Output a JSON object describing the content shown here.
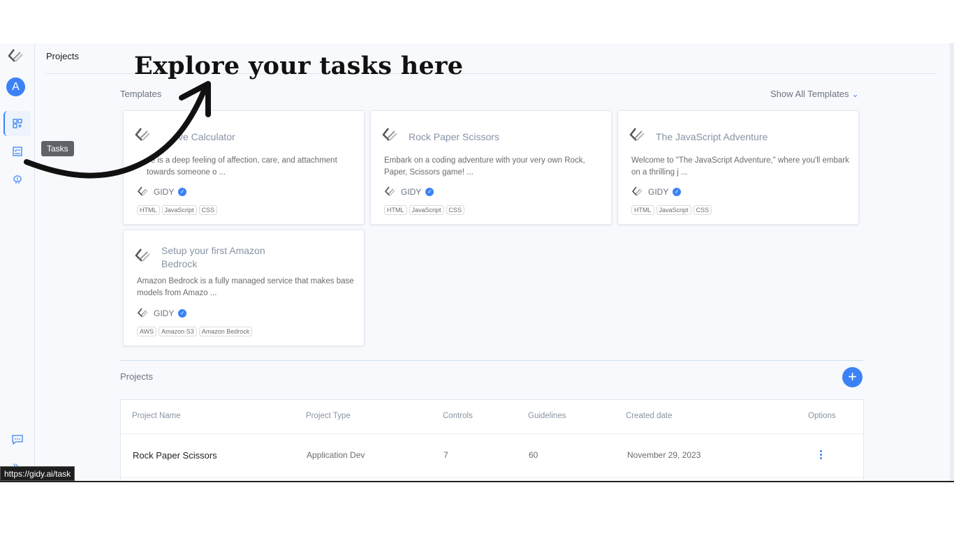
{
  "page": {
    "breadcrumb": "Projects"
  },
  "sidebar": {
    "avatar_letter": "A",
    "tooltip": "Tasks"
  },
  "annotation": {
    "text": "Explore your tasks here"
  },
  "templates": {
    "heading": "Templates",
    "show_all_label": "Show All Templates",
    "cards": [
      {
        "title": "Love Calculator",
        "title_visible": "ve Calculator",
        "description": "Love is a deep feeling of affection, care, and attachment towards someone o ...",
        "description_visible": "ve is a deep feeling of affection, care, and attachment towards someone o ...",
        "author": "GIDY",
        "tags": [
          "HTML",
          "JavaScript",
          "CSS"
        ]
      },
      {
        "title": "Rock Paper Scissors",
        "description": "Embark on a coding adventure with your very own Rock, Paper, Scissors game! ...",
        "author": "GIDY",
        "tags": [
          "HTML",
          "JavaScript",
          "CSS"
        ]
      },
      {
        "title": "The JavaScript Adventure",
        "description": "Welcome to \"The JavaScript Adventure,\" where you'll embark on a thrilling j ...",
        "author": "GIDY",
        "tags": [
          "HTML",
          "JavaScript",
          "CSS"
        ]
      },
      {
        "title": "Setup your first Amazon Bedrock",
        "description": "Amazon Bedrock is a fully managed service that makes base models from Amazo ...",
        "author": "GIDY",
        "tags": [
          "AWS",
          "Amazon S3",
          "Amazon Bedrock"
        ]
      }
    ]
  },
  "projects": {
    "heading": "Projects",
    "add_label": "+",
    "columns": [
      "Project Name",
      "Project Type",
      "Controls",
      "Guidelines",
      "Created date",
      "Options"
    ],
    "rows": [
      {
        "name": "Rock Paper Scissors",
        "type": "Application Dev",
        "controls": "7",
        "guidelines": "60",
        "created": "November 29, 2023"
      }
    ]
  },
  "status_url": "https://gidy.ai/task",
  "colors": {
    "accent": "#3b82f6",
    "background": "#f7f9fc"
  }
}
